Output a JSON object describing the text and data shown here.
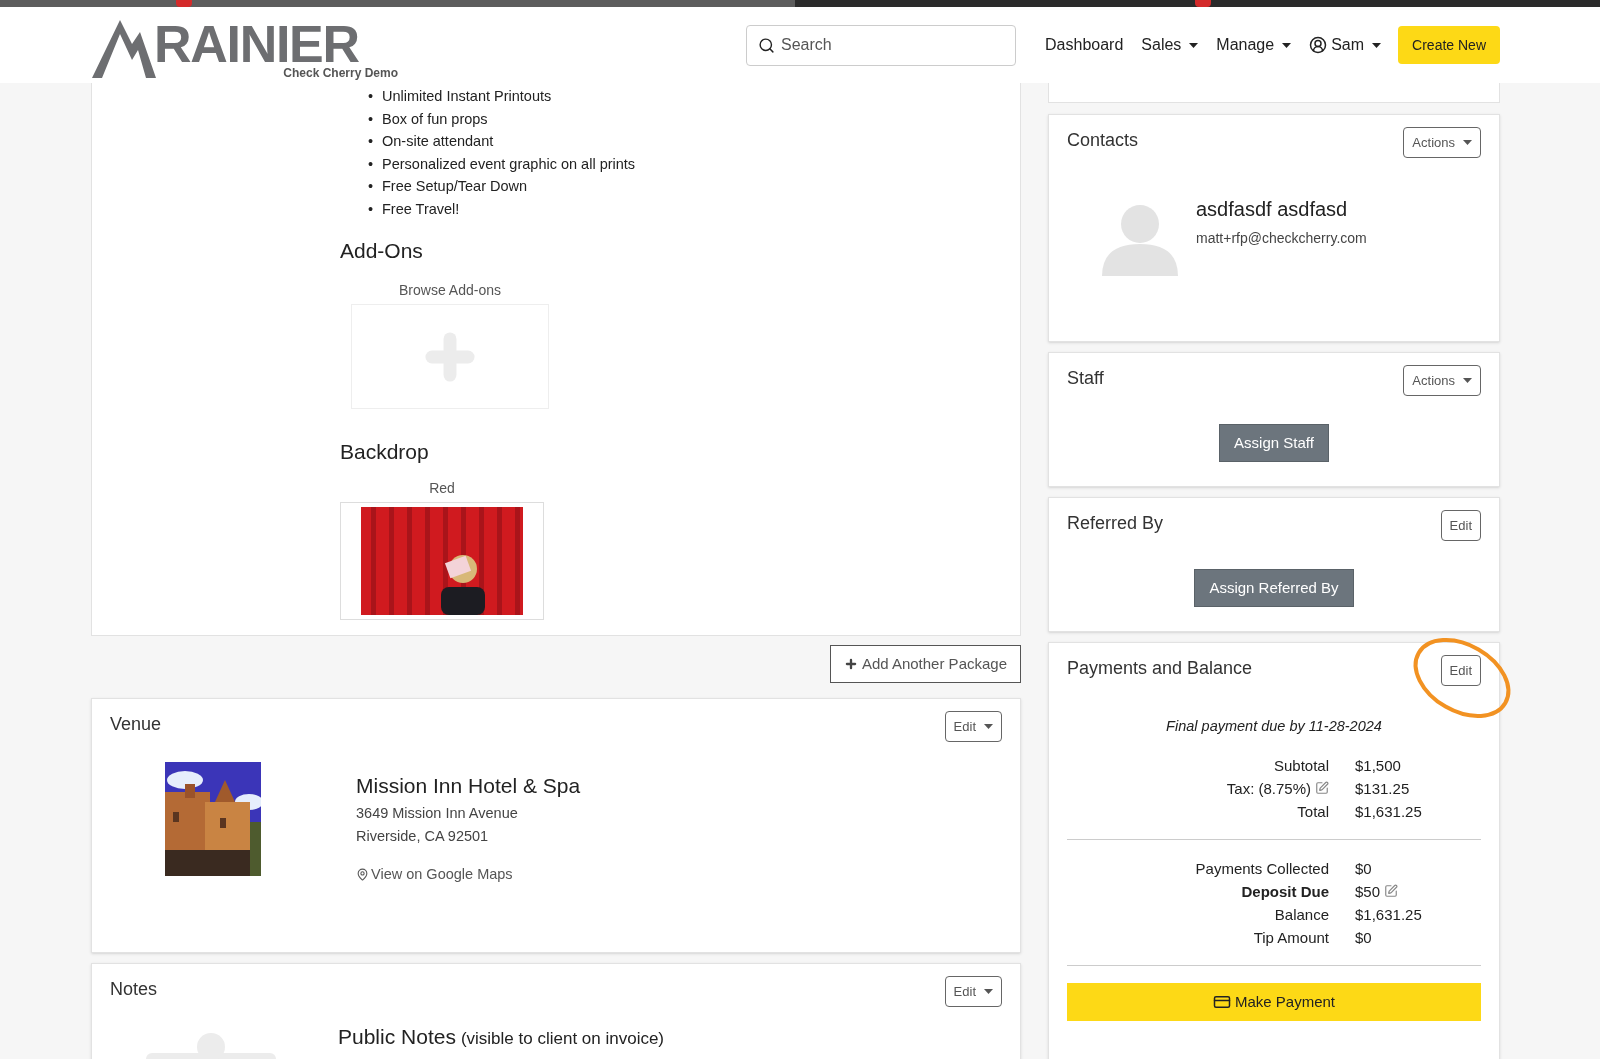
{
  "header": {
    "logo": {
      "name": "RAINIER",
      "subtitle": "Check Cherry Demo"
    },
    "search": {
      "placeholder": "Search"
    },
    "nav": [
      {
        "label": "Dashboard",
        "dropdown": false,
        "kind": "link"
      },
      {
        "label": "Sales",
        "dropdown": true,
        "kind": "link"
      },
      {
        "label": "Manage",
        "dropdown": true,
        "kind": "link"
      },
      {
        "label": "Sam",
        "dropdown": true,
        "kind": "user"
      }
    ],
    "create_button": "Create New"
  },
  "package": {
    "marker": "•",
    "features": [
      "Unlimited Instant Printouts",
      "Box of fun props",
      "On-site attendant",
      "Personalized event graphic on all prints",
      "Free Setup/Tear Down",
      "Free Travel!"
    ],
    "addons": {
      "title": "Add-Ons",
      "browse_label": "Browse Add-ons"
    },
    "backdrop": {
      "title": "Backdrop",
      "name": "Red"
    }
  },
  "add_package_button": "Add Another Package",
  "venue": {
    "title": "Venue",
    "edit_button": "Edit",
    "name": "Mission Inn Hotel & Spa",
    "address": [
      "3649 Mission Inn Avenue",
      "Riverside, CA 92501"
    ],
    "map_link": "View on Google Maps"
  },
  "notes": {
    "title": "Notes",
    "edit_button": "Edit",
    "public_notes_title": "Public Notes",
    "public_notes_hint": "(visible to client on invoice)"
  },
  "contacts": {
    "title": "Contacts",
    "actions_button": "Actions",
    "name": "asdfasdf asdfasd",
    "email": "matt+rfp@checkcherry.com"
  },
  "staff": {
    "title": "Staff",
    "actions_button": "Actions",
    "assign_button": "Assign Staff"
  },
  "referred_by": {
    "title": "Referred By",
    "edit_button": "Edit",
    "assign_button": "Assign Referred By"
  },
  "payments": {
    "title": "Payments and Balance",
    "edit_button": "Edit",
    "due_note": "Final payment due by 11-28-2024",
    "summary": [
      {
        "label": "Subtotal",
        "value": "$1,500",
        "bold": false,
        "label_editable": false,
        "value_editable": false
      },
      {
        "label": "Tax: (8.75%)",
        "value": "$131.25",
        "bold": false,
        "label_editable": true,
        "value_editable": false
      },
      {
        "label": "Total",
        "value": "$1,631.25",
        "bold": false,
        "label_editable": false,
        "value_editable": false
      }
    ],
    "balance": [
      {
        "label": "Payments Collected",
        "value": "$0",
        "bold": false,
        "label_editable": false,
        "value_editable": false
      },
      {
        "label": "Deposit Due",
        "value": "$50",
        "bold": true,
        "label_editable": false,
        "value_editable": true
      },
      {
        "label": "Balance",
        "value": "$1,631.25",
        "bold": false,
        "label_editable": false,
        "value_editable": false
      },
      {
        "label": "Tip Amount",
        "value": "$0",
        "bold": false,
        "label_editable": false,
        "value_editable": false
      }
    ],
    "pay_button": "Make Payment"
  }
}
